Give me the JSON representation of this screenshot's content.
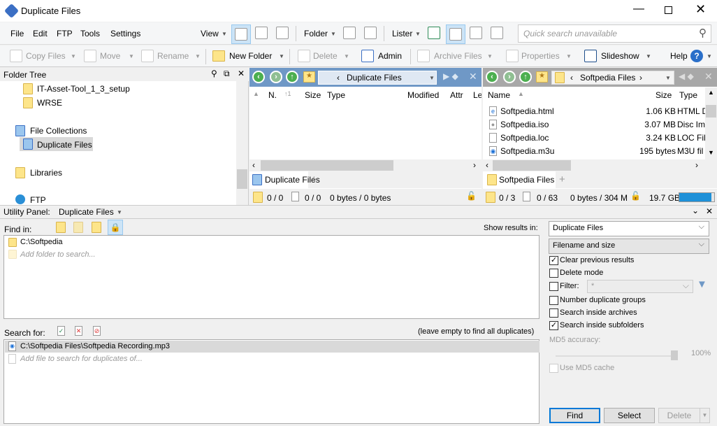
{
  "window": {
    "title": "Duplicate Files"
  },
  "menu": [
    "File",
    "Edit",
    "FTP",
    "Tools",
    "Settings"
  ],
  "toolbar1": {
    "view": "View",
    "folder": "Folder",
    "lister": "Lister",
    "quick_search_placeholder": "Quick search unavailable"
  },
  "toolbar2": {
    "copy": "Copy Files",
    "move": "Move",
    "rename": "Rename",
    "new_folder": "New Folder",
    "delete": "Delete",
    "admin": "Admin",
    "archive": "Archive Files",
    "properties": "Properties",
    "slideshow": "Slideshow",
    "help": "Help"
  },
  "tree": {
    "title": "Folder Tree",
    "items": [
      "IT-Asset-Tool_1_3_setup",
      "WRSE",
      "File Collections",
      "Duplicate Files",
      "Libraries",
      "FTP"
    ]
  },
  "left_pane": {
    "path": "Duplicate Files",
    "columns": [
      "N.",
      "Size",
      "Type",
      "Modified",
      "Attr",
      "Le"
    ],
    "tab": "Duplicate Files",
    "status": {
      "folders": "0 / 0",
      "files": "0 / 0",
      "bytes": "0 bytes / 0 bytes"
    }
  },
  "right_pane": {
    "path": "Softpedia Files",
    "columns": [
      "Name",
      "Size",
      "Type"
    ],
    "files": [
      {
        "name": "Softpedia.html",
        "size": "1.06 KB",
        "type": "HTML D"
      },
      {
        "name": "Softpedia.iso",
        "size": "3.07 MB",
        "type": "Disc Im"
      },
      {
        "name": "Softpedia.loc",
        "size": "3.24 KB",
        "type": "LOC Fil"
      },
      {
        "name": "Softpedia.m3u",
        "size": "195 bytes",
        "type": "M3U fil"
      }
    ],
    "tab": "Softpedia Files",
    "status": {
      "folders": "0 / 3",
      "files": "0 / 63",
      "bytes": "0 bytes / 304 M",
      "free": "19.7 GB"
    },
    "disk_used_fraction": 0.92
  },
  "utility": {
    "label": "Utility Panel:",
    "mode": "Duplicate Files",
    "find_in": "Find in:",
    "find_paths": [
      "C:\\Softpedia"
    ],
    "find_placeholder": "Add folder to search...",
    "search_for": "Search for:",
    "search_hint": "(leave empty to find all duplicates)",
    "search_files": [
      "C:\\Softpedia Files\\Softpedia Recording.mp3"
    ],
    "search_placeholder": "Add file to search for duplicates of...",
    "show_results_label": "Show results in:",
    "show_results": "Duplicate Files",
    "match": "Filename and size",
    "options": [
      {
        "label": "Clear previous results",
        "checked": true
      },
      {
        "label": "Delete mode",
        "checked": false
      },
      {
        "label": "Filter:",
        "checked": false
      },
      {
        "label": "Number duplicate groups",
        "checked": false
      },
      {
        "label": "Search inside archives",
        "checked": false
      },
      {
        "label": "Search inside subfolders",
        "checked": true
      }
    ],
    "filter_value": "*",
    "md5_label": "MD5 accuracy:",
    "md5_value": "100%",
    "md5_cache": "Use MD5 cache",
    "find": "Find",
    "select": "Select",
    "delete": "Delete"
  }
}
